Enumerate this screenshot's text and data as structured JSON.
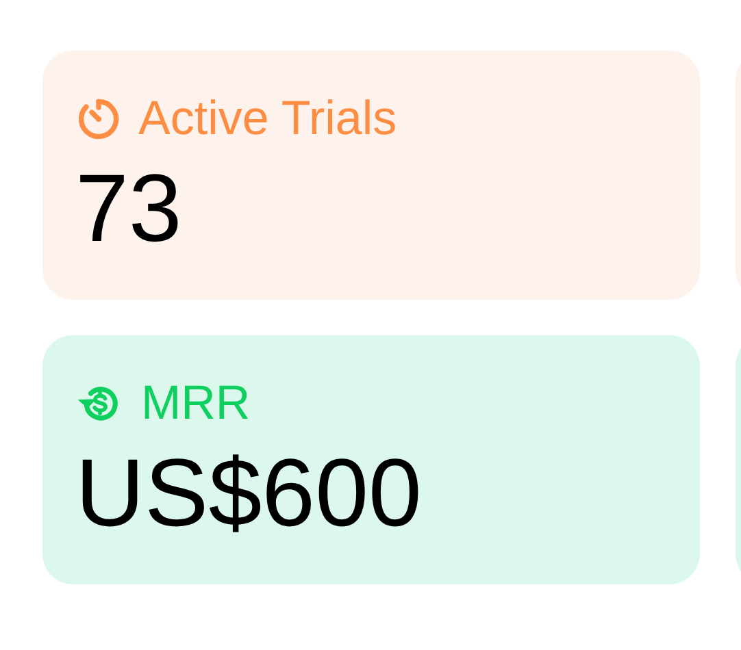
{
  "cards": [
    {
      "kind": "timer",
      "label": "Active Trials",
      "value": "73",
      "color": "#fc8d43"
    },
    {
      "kind": "revenue",
      "label": "MRR",
      "value": "US$600",
      "color": "#0fcf5e"
    }
  ]
}
